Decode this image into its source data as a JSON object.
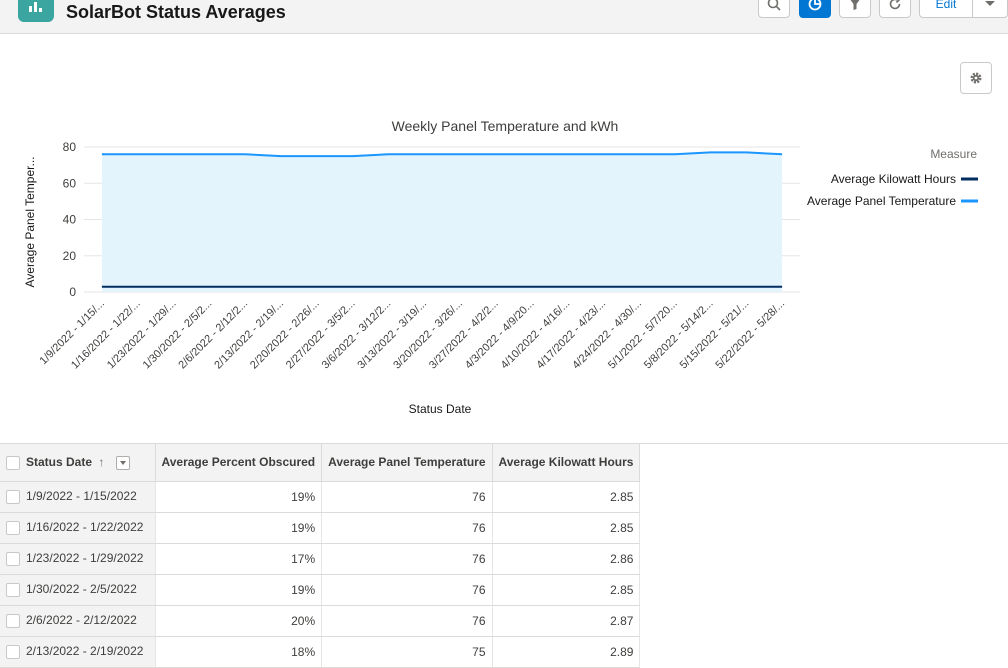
{
  "header": {
    "title": "SolarBot Status Averages",
    "edit_label": "Edit"
  },
  "chart_data": {
    "type": "area",
    "title": "Weekly Panel Temperature and kWh",
    "xlabel": "Status Date",
    "ylabel": "Average Panel Temper...",
    "ylim": [
      0,
      80
    ],
    "yticks": [
      0,
      20,
      40,
      60,
      80
    ],
    "legend_title": "Measure",
    "legend_position": "right",
    "categories": [
      "1/9/2022 - 1/15/...",
      "1/16/2022 - 1/22/...",
      "1/23/2022 - 1/29/...",
      "1/30/2022 - 2/5/2...",
      "2/6/2022 - 2/12/2...",
      "2/13/2022 - 2/19/...",
      "2/20/2022 - 2/26/...",
      "2/27/2022 - 3/5/2...",
      "3/6/2022 - 3/12/2...",
      "3/13/2022 - 3/19/...",
      "3/20/2022 - 3/26/...",
      "3/27/2022 - 4/2/2...",
      "4/3/2022 - 4/9/20...",
      "4/10/2022 - 4/16/...",
      "4/17/2022 - 4/23/...",
      "4/24/2022 - 4/30/...",
      "5/1/2022 - 5/7/20...",
      "5/8/2022 - 5/14/2...",
      "5/15/2022 - 5/21/...",
      "5/22/2022 - 5/28/..."
    ],
    "series": [
      {
        "name": "Average Kilowatt Hours",
        "color": "#032d60",
        "values": [
          2.85,
          2.85,
          2.86,
          2.85,
          2.87,
          2.89,
          2.9,
          2.88,
          2.87,
          2.9,
          2.9,
          2.88,
          2.87,
          2.86,
          2.86,
          2.86,
          2.86,
          2.86,
          2.86,
          2.86
        ]
      },
      {
        "name": "Average Panel Temperature",
        "color": "#1b96ff",
        "fill": "#e3f4fd",
        "values": [
          76,
          76,
          76,
          76,
          76,
          75,
          75,
          75,
          76,
          76,
          76,
          76,
          76,
          76,
          76,
          76,
          76,
          77,
          77,
          76
        ]
      }
    ]
  },
  "table": {
    "columns": [
      "Status Date",
      "Average Percent Obscured",
      "Average Panel Temperature",
      "Average Kilowatt Hours"
    ],
    "sort_icon": "↑",
    "rows": [
      [
        "1/9/2022 - 1/15/2022",
        "19%",
        "76",
        "2.85"
      ],
      [
        "1/16/2022 - 1/22/2022",
        "19%",
        "76",
        "2.85"
      ],
      [
        "1/23/2022 - 1/29/2022",
        "17%",
        "76",
        "2.86"
      ],
      [
        "1/30/2022 - 2/5/2022",
        "19%",
        "76",
        "2.85"
      ],
      [
        "2/6/2022 - 2/12/2022",
        "20%",
        "76",
        "2.87"
      ],
      [
        "2/13/2022 - 2/19/2022",
        "18%",
        "75",
        "2.89"
      ]
    ]
  }
}
